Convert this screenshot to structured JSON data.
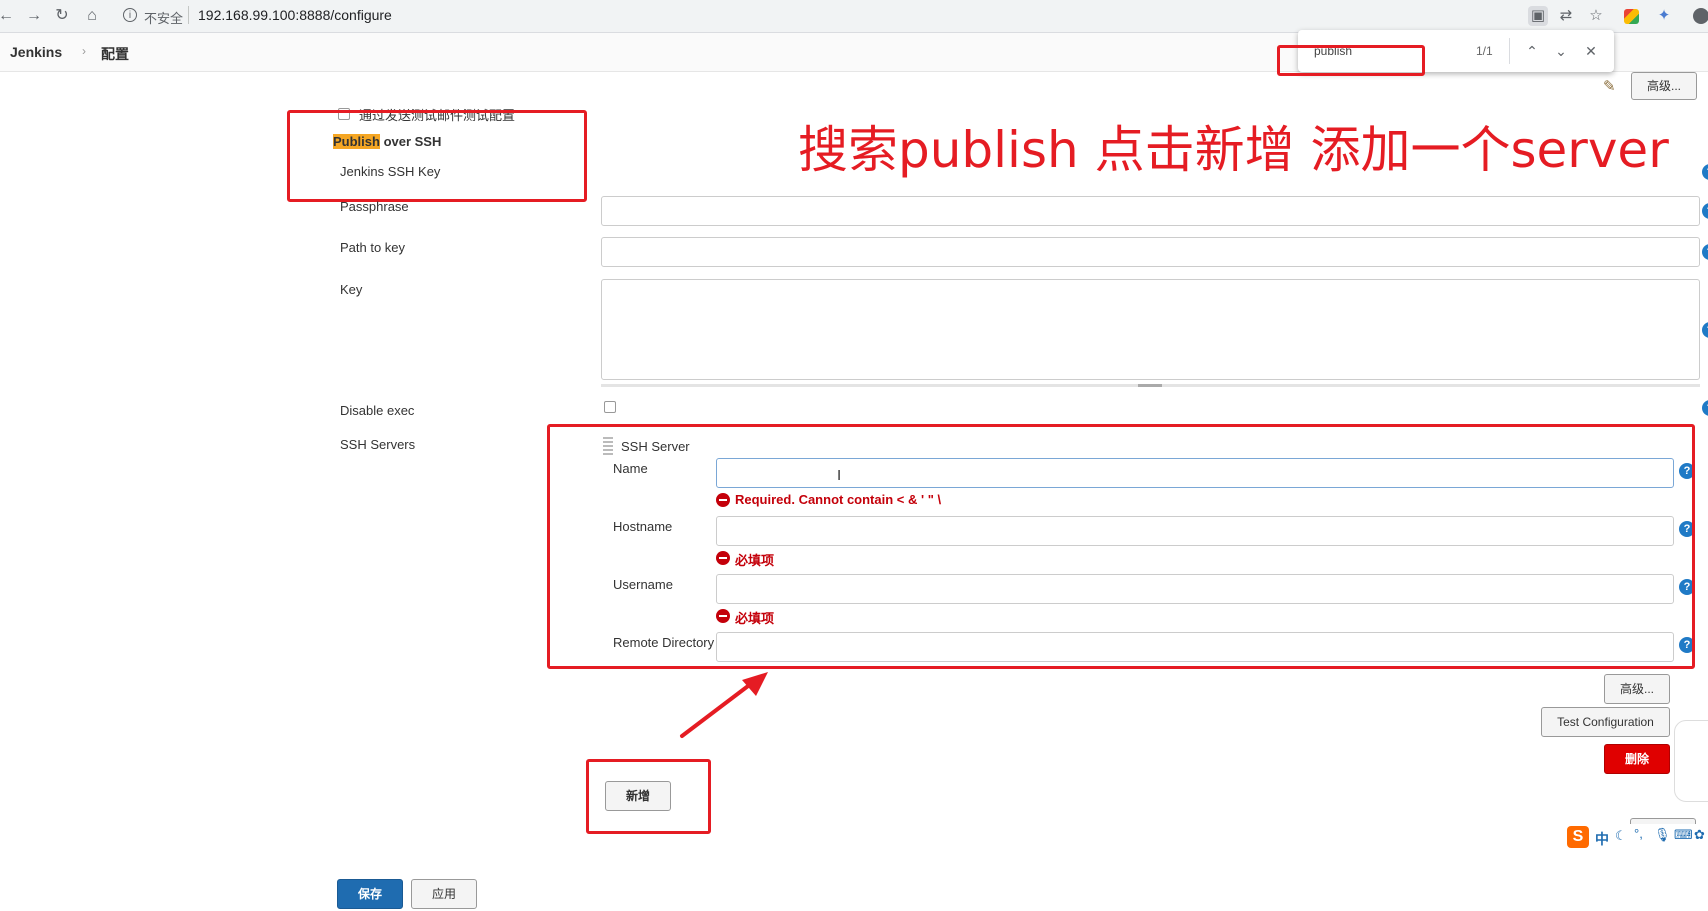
{
  "browser": {
    "security_label": "不安全",
    "url": "192.168.99.100:8888/configure",
    "icons": [
      "back-icon",
      "forward-icon",
      "reload-icon",
      "home-icon",
      "info-icon",
      "screenshot-icon",
      "translate-icon",
      "star-icon",
      "extension-icon",
      "profile-icon"
    ]
  },
  "header": {
    "brand": "Jenkins",
    "separator": "›",
    "page": "配置"
  },
  "find_bar": {
    "query": "publish",
    "count": "1/1"
  },
  "annotation": {
    "text": "搜索publish  点击新增 添加一个server",
    "color": "#e51c23"
  },
  "form": {
    "top_checkbox_label": "通过发送测试邮件测试配置",
    "advanced_button": "高级...",
    "section": {
      "title_highlight": "Publish",
      "title_rest": " over SSH",
      "highlight_color": "#f5a623"
    },
    "labels": {
      "jenkins_ssh_key": "Jenkins SSH Key",
      "passphrase": "Passphrase",
      "path_to_key": "Path to key",
      "key": "Key",
      "disable_exec": "Disable exec",
      "ssh_servers": "SSH Servers"
    },
    "ssh_server": {
      "title": "SSH Server",
      "name_label": "Name",
      "name_value": "",
      "name_error": "Required. Cannot contain < & ' \" \\",
      "hostname_label": "Hostname",
      "hostname_value": "",
      "hostname_error": "必填项",
      "username_label": "Username",
      "username_value": "",
      "username_error": "必填项",
      "remote_directory_label": "Remote Directory",
      "remote_directory_value": "",
      "advanced_button": "高级...",
      "test_button": "Test Configuration",
      "delete_button": "删除"
    },
    "add_button": "新增",
    "save_button": "保存",
    "apply_button": "应用"
  },
  "ime": {
    "logo": "S",
    "mode": "中"
  },
  "colors": {
    "annotation_red": "#e51c23",
    "save_blue": "#1f6cb0",
    "delete_red": "#e00000",
    "help_blue": "#1f7ac6",
    "error_red": "#c4000a"
  }
}
